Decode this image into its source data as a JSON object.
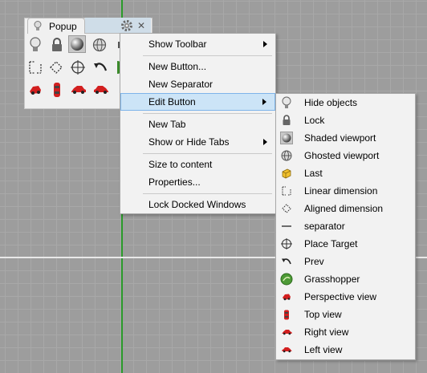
{
  "toolbar_panel": {
    "tab_label": "Popup",
    "close_glyph": "✕",
    "tools": [
      {
        "name": "hide-objects-tool-icon"
      },
      {
        "name": "lock-tool-icon"
      },
      {
        "name": "shaded-viewport-tool-icon",
        "selected": true
      },
      {
        "name": "ghosted-viewport-tool-icon"
      },
      {
        "name": "linear-dimension-tool-icon"
      },
      {
        "name": "aligned-dimension-tool-icon"
      },
      {
        "name": "place-target-tool-icon"
      },
      {
        "name": "prev-tool-icon"
      },
      {
        "name": "grasshopper-tool-icon"
      },
      {
        "name": "perspective-view-tool-icon"
      },
      {
        "name": "top-view-tool-icon"
      },
      {
        "name": "right-view-tool-icon"
      },
      {
        "name": "left-view-tool-icon"
      }
    ]
  },
  "context_menu": {
    "items": [
      {
        "label": "Show Toolbar",
        "submenu": true
      },
      {
        "label": "New Button..."
      },
      {
        "label": "New Separator"
      },
      {
        "label": "Edit Button",
        "submenu": true,
        "highlighted": true
      },
      {
        "label": "New Tab"
      },
      {
        "label": "Show or Hide Tabs",
        "submenu": true
      },
      {
        "label": "Size to content"
      },
      {
        "label": "Properties..."
      },
      {
        "label": "Lock Docked Windows"
      }
    ]
  },
  "submenu": {
    "items": [
      {
        "label": "Hide objects",
        "icon": "lightbulb-icon"
      },
      {
        "label": "Lock",
        "icon": "padlock-icon"
      },
      {
        "label": "Shaded viewport",
        "icon": "shaded-sphere-icon"
      },
      {
        "label": "Ghosted viewport",
        "icon": "ghosted-sphere-icon"
      },
      {
        "label": "Last",
        "icon": "last-cube-icon"
      },
      {
        "label": "Linear dimension",
        "icon": "linear-dimension-icon"
      },
      {
        "label": "Aligned dimension",
        "icon": "aligned-dimension-icon"
      },
      {
        "label": "separator",
        "icon": "separator-line-icon"
      },
      {
        "label": "Place Target",
        "icon": "target-icon"
      },
      {
        "label": "Prev",
        "icon": "prev-arrow-icon"
      },
      {
        "label": "Grasshopper",
        "icon": "grasshopper-icon"
      },
      {
        "label": "Perspective view",
        "icon": "perspective-car-icon"
      },
      {
        "label": "Top view",
        "icon": "top-car-icon"
      },
      {
        "label": "Right view",
        "icon": "right-car-icon"
      },
      {
        "label": "Left view",
        "icon": "left-car-icon"
      }
    ]
  },
  "colors": {
    "viewport_bg": "#9d9d9d",
    "y_axis": "#2a9a2a",
    "x_axis": "#e8e8e8",
    "menu_bg": "#f2f2f2",
    "highlight_bg": "#cce4f7",
    "highlight_border": "#7eb4ea",
    "tab_strip": "#cfdde8"
  }
}
